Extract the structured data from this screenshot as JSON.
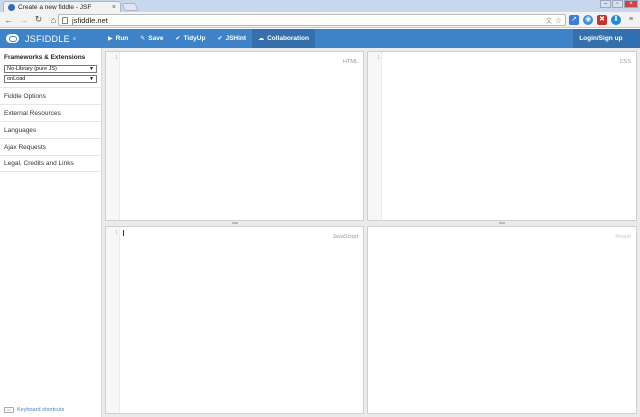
{
  "browser": {
    "tab_title": "Create a new fiddle - JSF",
    "tab_close": "×",
    "url": "jsfiddle.net"
  },
  "app": {
    "logo_text": "JSFIDDLE",
    "logo_version": "α",
    "actions": [
      {
        "icon": "play-icon",
        "glyph": "▶",
        "label": "Run"
      },
      {
        "icon": "save-icon",
        "glyph": "✎",
        "label": "Save"
      },
      {
        "icon": "check-icon",
        "glyph": "✔",
        "label": "TidyUp"
      },
      {
        "icon": "check-icon",
        "glyph": "✔",
        "label": "JSHint"
      },
      {
        "icon": "cloud-icon",
        "glyph": "☁",
        "label": "Collaboration"
      }
    ],
    "login_label": "Login/Sign up"
  },
  "sidebar": {
    "heading": "Frameworks & Extensions",
    "framework_select": "No-Library (pure JS)",
    "load_select": "onLoad",
    "items": [
      {
        "label": "Fiddle Options"
      },
      {
        "label": "External Resources"
      },
      {
        "label": "Languages"
      },
      {
        "label": "Ajax Requests"
      },
      {
        "label": "Legal, Credits and Links"
      }
    ],
    "keyboard_shortcuts": "Keyboard shortcuts"
  },
  "panels": {
    "html": {
      "label": "HTML",
      "line": "1"
    },
    "css": {
      "label": "CSS",
      "line": "1"
    },
    "javascript": {
      "label": "JavaScript",
      "line": "1"
    },
    "result": {
      "label": "Result"
    }
  },
  "colors": {
    "header_blue": "#3e83c8",
    "collab_blue": "#356fac"
  }
}
